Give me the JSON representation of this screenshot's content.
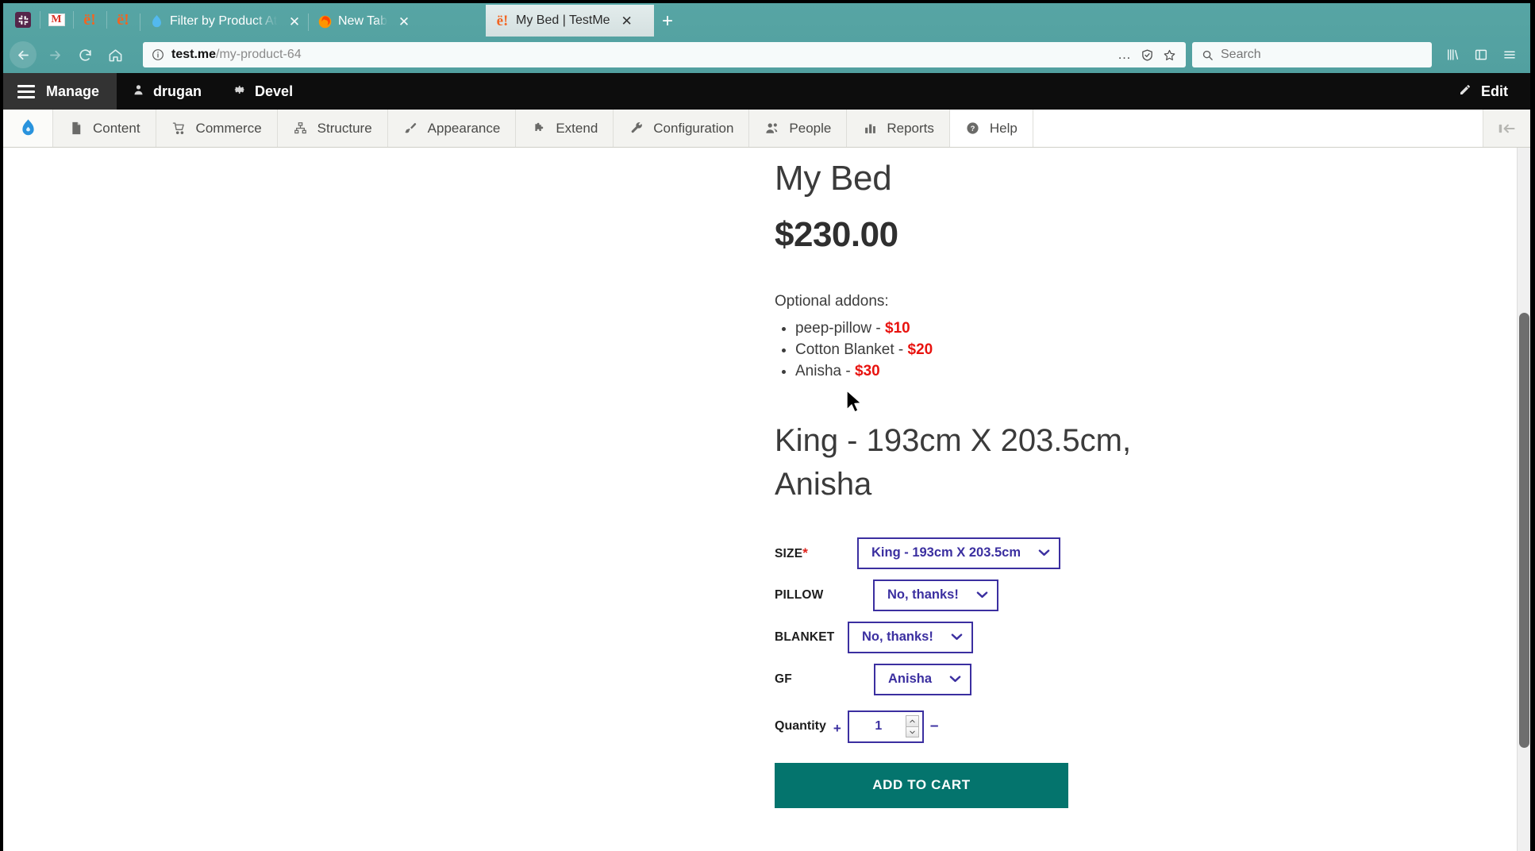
{
  "browser": {
    "pinned_tabs": [
      {
        "name": "slack-pinned-tab",
        "icon": "slack-icon",
        "glyph": "✳"
      },
      {
        "name": "gmail-pinned-tab",
        "icon": "gmail-icon",
        "glyph": "M"
      },
      {
        "name": "drupal-pinned-tab-1",
        "icon": "drupal-e-icon",
        "glyph": "ë!"
      },
      {
        "name": "drupal-pinned-tab-2",
        "icon": "drupal-e-icon",
        "glyph": "ë!"
      }
    ],
    "tabs": [
      {
        "title": "Filter by Product Att",
        "icon": "drupal-droplet-icon",
        "active": false,
        "close_label": "✕"
      },
      {
        "title": "New Tab",
        "icon": "firefox-icon",
        "active": false,
        "close_label": "✕"
      },
      {
        "title": "My Bed | TestMe",
        "icon": "drupal-e-icon",
        "active": true,
        "close_label": "✕"
      }
    ],
    "new_tab_label": "+",
    "nav": {
      "back_label": "←",
      "forward_label": "→",
      "reload_label": "⟳",
      "home_label": "⌂"
    },
    "url": {
      "host": "test.me",
      "path": "/my-product-64",
      "info_icon": "info-circle-icon",
      "page_actions_label": "…",
      "shield_label": "⛨",
      "bookmark_label": "☆"
    },
    "search": {
      "placeholder": "Search",
      "value": "",
      "icon": "search-icon"
    },
    "right_icons": [
      {
        "name": "library-icon",
        "glyph": "|||\\"
      },
      {
        "name": "sidebar-icon",
        "glyph": "▯"
      },
      {
        "name": "app-menu-icon",
        "glyph": "☰"
      }
    ]
  },
  "admin_toolbar": {
    "manage_label": "Manage",
    "user_label": "drugan",
    "devel_label": "Devel",
    "edit_label": "Edit"
  },
  "admin_menu": {
    "logo_icon": "drupal-droplet-icon",
    "items": [
      {
        "label": "Content",
        "icon": "document-icon",
        "glyph": "🗎"
      },
      {
        "label": "Commerce",
        "icon": "cart-icon",
        "glyph": "🛒"
      },
      {
        "label": "Structure",
        "icon": "sitemap-icon",
        "glyph": "⛬"
      },
      {
        "label": "Appearance",
        "icon": "paintbrush-icon",
        "glyph": "✎"
      },
      {
        "label": "Extend",
        "icon": "puzzle-icon",
        "glyph": "🧩"
      },
      {
        "label": "Configuration",
        "icon": "wrench-icon",
        "glyph": "🔧"
      },
      {
        "label": "People",
        "icon": "people-icon",
        "glyph": "👥"
      },
      {
        "label": "Reports",
        "icon": "bar-chart-icon",
        "glyph": "📊"
      },
      {
        "label": "Help",
        "icon": "question-circle-icon",
        "glyph": "?"
      }
    ],
    "collapse_icon": "collapse-left-icon"
  },
  "product": {
    "title": "My Bed",
    "price": "$230.00",
    "addons_heading": "Optional addons:",
    "addons": [
      {
        "name": "peep-pillow",
        "separator": " - ",
        "amount": "$10"
      },
      {
        "name": "Cotton Blanket",
        "separator": " - ",
        "amount": "$20"
      },
      {
        "name": "Anisha",
        "separator": " - ",
        "amount": "$30"
      }
    ],
    "variation_title": "King - 193cm X 203.5cm, Anisha",
    "form": {
      "fields": [
        {
          "label": "SIZE",
          "required": true,
          "value": "King - 193cm X 203.5cm",
          "caret": "❯"
        },
        {
          "label": "PILLOW",
          "required": false,
          "value": "No, thanks!",
          "caret": "❯"
        },
        {
          "label": "BLANKET",
          "required": false,
          "value": "No, thanks!",
          "caret": "❯"
        },
        {
          "label": "GF",
          "required": false,
          "value": "Anisha",
          "caret": "❯"
        }
      ],
      "quantity": {
        "label": "Quantity",
        "plus_label": "+",
        "minus_label": "–",
        "value": "1",
        "spinner_up": "▲",
        "spinner_down": "▼"
      },
      "add_to_cart_label": "ADD TO CART"
    }
  },
  "colors": {
    "chrome_teal": "#55a3a3",
    "admin_black": "#0d0d0d",
    "accent_indigo": "#3b2fa0",
    "cart_green": "#04746d",
    "price_red": "#e8130f"
  }
}
